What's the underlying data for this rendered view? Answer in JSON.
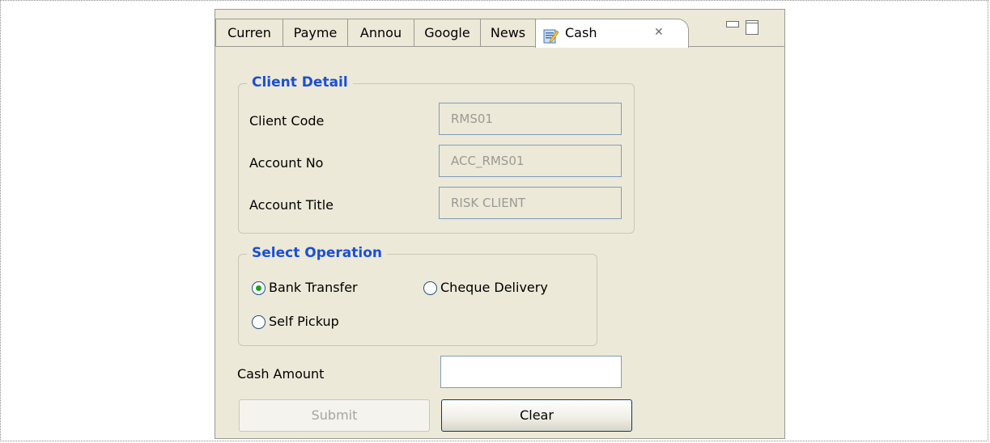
{
  "tabs": [
    {
      "label": "Curren"
    },
    {
      "label": "Payme"
    },
    {
      "label": "Annou"
    },
    {
      "label": "Google"
    },
    {
      "label": "News"
    },
    {
      "label": "Cash",
      "active": true,
      "icon": "edit-form-icon"
    }
  ],
  "tab_close_glyph": "✕",
  "client_detail": {
    "title": "Client Detail",
    "client_code_label": "Client Code",
    "client_code_value": "RMS01",
    "account_no_label": "Account No",
    "account_no_value": "ACC_RMS01",
    "account_title_label": "Account Title",
    "account_title_value": "RISK CLIENT"
  },
  "select_operation": {
    "title": "Select Operation",
    "options": [
      {
        "label": "Bank Transfer",
        "checked": true
      },
      {
        "label": "Cheque Delivery",
        "checked": false
      },
      {
        "label": "Self Pickup",
        "checked": false
      }
    ]
  },
  "cash_amount": {
    "label": "Cash Amount",
    "value": ""
  },
  "buttons": {
    "submit_label": "Submit",
    "clear_label": "Clear"
  },
  "colors": {
    "group_title": "#1a4fd6",
    "panel_bg": "#ece9d8",
    "radio_checked": "#21a121"
  }
}
